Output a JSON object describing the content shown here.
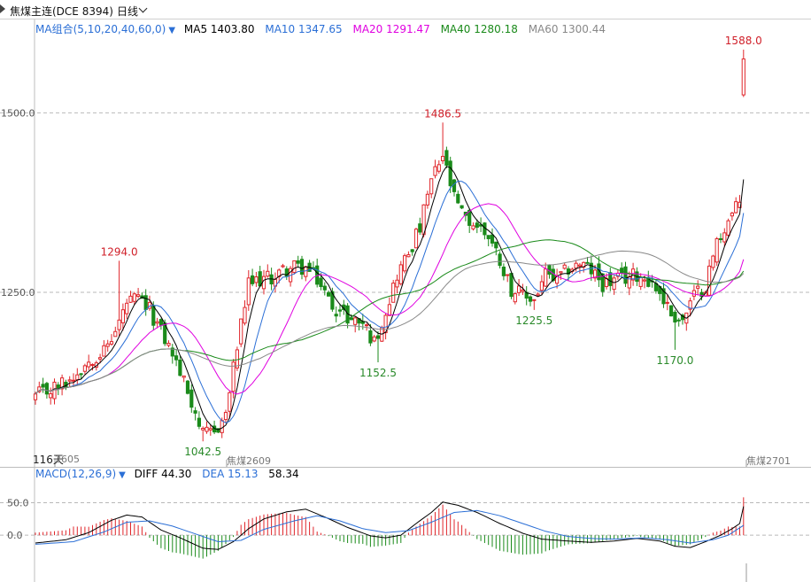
{
  "header": {
    "instrument": "焦煤主连(DCE 8394)",
    "period": "日线"
  },
  "colors": {
    "up": "#e0262b",
    "down": "#1a8a1a",
    "ma5": "#000000",
    "ma10": "#2b6fd6",
    "ma20": "#e000e0",
    "ma40": "#1a8a1a",
    "ma60": "#888888",
    "diff": "#000000",
    "dea": "#2b6fd6",
    "peak_label": "#d0202a",
    "trough_label": "#2a8a2a",
    "axis_text": "#555555"
  },
  "ma_legend": {
    "title": "MA组合(5,10,20,40,60,0)",
    "ma5": "MA5 1403.80",
    "ma10": "MA10 1347.65",
    "ma20": "MA20 1291.47",
    "ma40": "MA40 1280.18",
    "ma60": "MA60 1300.44"
  },
  "macd_legend": {
    "title": "MACD(12,26,9)",
    "diff": "DIFF 44.30",
    "dea": "DEA 15.13",
    "macd": "58.34"
  },
  "x_labels": {
    "days": "116天",
    "c1": "2605",
    "c2": "焦煤2609",
    "c3": "焦煤2701"
  },
  "chart_data": [
    {
      "type": "candlestick",
      "y_ticks": [
        1250,
        1500
      ],
      "y_tick_labels": [
        "1250.0",
        "1500.0"
      ],
      "ylim": [
        1007,
        1630
      ],
      "grid": "dashed horizontal",
      "annotations": [
        {
          "text": "1294.0",
          "index": 22,
          "value": 1294,
          "kind": "peak"
        },
        {
          "text": "1042.5",
          "index": 44,
          "value": 1042.5,
          "kind": "trough"
        },
        {
          "text": "1152.5",
          "index": 90,
          "value": 1152.5,
          "kind": "trough"
        },
        {
          "text": "1486.5",
          "index": 107,
          "value": 1486.5,
          "kind": "peak"
        },
        {
          "text": "1225.5",
          "index": 131,
          "value": 1225.5,
          "kind": "trough"
        },
        {
          "text": "1170.0",
          "index": 168,
          "value": 1170,
          "kind": "trough"
        },
        {
          "text": "1588.0",
          "index": 186,
          "value": 1588,
          "kind": "peak"
        }
      ],
      "anchors": [
        [
          0,
          1105
        ],
        [
          3,
          1112
        ],
        [
          6,
          1120
        ],
        [
          9,
          1128
        ],
        [
          12,
          1145
        ],
        [
          15,
          1160
        ],
        [
          18,
          1168
        ],
        [
          21,
          1195
        ],
        [
          24,
          1235
        ],
        [
          27,
          1240
        ],
        [
          30,
          1225
        ],
        [
          33,
          1195
        ],
        [
          36,
          1165
        ],
        [
          39,
          1125
        ],
        [
          42,
          1085
        ],
        [
          44,
          1050
        ],
        [
          47,
          1055
        ],
        [
          50,
          1080
        ],
        [
          53,
          1175
        ],
        [
          56,
          1260
        ],
        [
          59,
          1268
        ],
        [
          62,
          1270
        ],
        [
          65,
          1280
        ],
        [
          68,
          1285
        ],
        [
          71,
          1283
        ],
        [
          74,
          1268
        ],
        [
          77,
          1240
        ],
        [
          80,
          1222
        ],
        [
          83,
          1212
        ],
        [
          86,
          1208
        ],
        [
          89,
          1180
        ],
        [
          92,
          1225
        ],
        [
          95,
          1275
        ],
        [
          98,
          1305
        ],
        [
          101,
          1340
        ],
        [
          104,
          1405
        ],
        [
          107,
          1440
        ],
        [
          110,
          1380
        ],
        [
          113,
          1350
        ],
        [
          116,
          1343
        ],
        [
          119,
          1330
        ],
        [
          122,
          1295
        ],
        [
          125,
          1255
        ],
        [
          128,
          1245
        ],
        [
          131,
          1240
        ],
        [
          134,
          1275
        ],
        [
          137,
          1265
        ],
        [
          140,
          1283
        ],
        [
          143,
          1290
        ],
        [
          146,
          1280
        ],
        [
          149,
          1262
        ],
        [
          152,
          1265
        ],
        [
          155,
          1270
        ],
        [
          158,
          1275
        ],
        [
          161,
          1268
        ],
        [
          164,
          1250
        ],
        [
          167,
          1220
        ],
        [
          170,
          1210
        ],
        [
          173,
          1245
        ],
        [
          176,
          1260
        ],
        [
          179,
          1320
        ],
        [
          182,
          1350
        ],
        [
          185,
          1375
        ],
        [
          186,
          1570
        ]
      ],
      "volatility": 11,
      "series": [
        {
          "name": "MA5",
          "color": "ma5",
          "window": 5
        },
        {
          "name": "MA10",
          "color": "ma10",
          "window": 10
        },
        {
          "name": "MA20",
          "color": "ma20",
          "window": 20
        },
        {
          "name": "MA40",
          "color": "ma40",
          "window": 40
        },
        {
          "name": "MA60",
          "color": "ma60",
          "window": 60
        }
      ]
    },
    {
      "type": "bar_line",
      "name": "MACD(12,26,9)",
      "y_ticks": [
        0,
        50
      ],
      "y_tick_labels": [
        "0.0",
        "50.0"
      ],
      "ylim": [
        -72,
        82
      ],
      "diff_anchors": [
        [
          0,
          -12
        ],
        [
          8,
          -7
        ],
        [
          14,
          4
        ],
        [
          20,
          23
        ],
        [
          24,
          31
        ],
        [
          28,
          28
        ],
        [
          33,
          8
        ],
        [
          38,
          -4
        ],
        [
          44,
          -20
        ],
        [
          48,
          -22
        ],
        [
          52,
          -10
        ],
        [
          56,
          10
        ],
        [
          60,
          25
        ],
        [
          66,
          36
        ],
        [
          71,
          40
        ],
        [
          76,
          28
        ],
        [
          82,
          12
        ],
        [
          88,
          -1
        ],
        [
          92,
          -4
        ],
        [
          96,
          0
        ],
        [
          100,
          18
        ],
        [
          104,
          35
        ],
        [
          107,
          51
        ],
        [
          111,
          46
        ],
        [
          116,
          35
        ],
        [
          122,
          18
        ],
        [
          128,
          3
        ],
        [
          133,
          -6
        ],
        [
          140,
          -9
        ],
        [
          146,
          -11
        ],
        [
          152,
          -9
        ],
        [
          158,
          -5
        ],
        [
          164,
          -9
        ],
        [
          168,
          -17
        ],
        [
          172,
          -19
        ],
        [
          176,
          -10
        ],
        [
          180,
          0
        ],
        [
          183,
          10
        ],
        [
          185,
          18
        ],
        [
          186,
          44.3
        ]
      ],
      "dea_anchors": [
        [
          0,
          -14
        ],
        [
          10,
          -10
        ],
        [
          18,
          5
        ],
        [
          24,
          20
        ],
        [
          30,
          22
        ],
        [
          36,
          14
        ],
        [
          42,
          2
        ],
        [
          48,
          -10
        ],
        [
          54,
          -8
        ],
        [
          60,
          9
        ],
        [
          68,
          22
        ],
        [
          74,
          30
        ],
        [
          80,
          22
        ],
        [
          86,
          10
        ],
        [
          92,
          4
        ],
        [
          98,
          7
        ],
        [
          104,
          20
        ],
        [
          110,
          35
        ],
        [
          116,
          38
        ],
        [
          122,
          30
        ],
        [
          128,
          18
        ],
        [
          134,
          6
        ],
        [
          140,
          -2
        ],
        [
          146,
          -5
        ],
        [
          152,
          -6
        ],
        [
          160,
          -4
        ],
        [
          166,
          -7
        ],
        [
          172,
          -12
        ],
        [
          178,
          -7
        ],
        [
          182,
          0
        ],
        [
          186,
          15.13
        ]
      ],
      "series": [
        {
          "name": "DIFF",
          "color": "diff"
        },
        {
          "name": "DEA",
          "color": "dea"
        },
        {
          "name": "MACD",
          "color": "up",
          "rule": "2*(DIFF-DEA)"
        }
      ]
    }
  ]
}
